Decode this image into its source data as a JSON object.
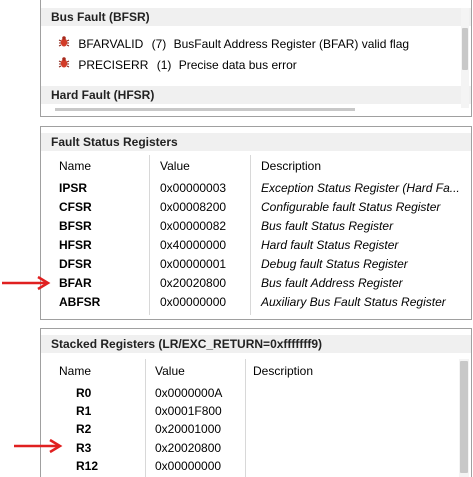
{
  "bfsr": {
    "title": "Bus Fault (BFSR)",
    "items": [
      {
        "name": "BFARVALID",
        "bit": "(7)",
        "desc": "BusFault Address Register (BFAR) valid flag"
      },
      {
        "name": "PRECISERR",
        "bit": "(1)",
        "desc": "Precise data bus error"
      }
    ],
    "next_title": "Hard Fault (HFSR)"
  },
  "fsr": {
    "title": "Fault Status Registers",
    "columns": [
      "Name",
      "Value",
      "Description"
    ],
    "rows": [
      {
        "name": "IPSR",
        "value": "0x00000003",
        "desc": "Exception Status Register (Hard Fa..."
      },
      {
        "name": "CFSR",
        "value": "0x00008200",
        "desc": "Configurable fault Status Register"
      },
      {
        "name": "BFSR",
        "value": "0x00000082",
        "desc": "Bus fault Status Register"
      },
      {
        "name": "HFSR",
        "value": "0x40000000",
        "desc": "Hard fault Status Register"
      },
      {
        "name": "DFSR",
        "value": "0x00000001",
        "desc": "Debug fault Status Register"
      },
      {
        "name": "BFAR",
        "value": "0x20020800",
        "desc": "Bus fault Address Register"
      },
      {
        "name": "ABFSR",
        "value": "0x00000000",
        "desc": "Auxiliary Bus Fault Status Register"
      }
    ]
  },
  "stacked": {
    "title": "Stacked Registers (LR/EXC_RETURN=0xfffffff9)",
    "columns": [
      "Name",
      "Value",
      "Description"
    ],
    "rows": [
      {
        "name": "R0",
        "value": "0x0000000A",
        "desc": ""
      },
      {
        "name": "R1",
        "value": "0x0001F800",
        "desc": ""
      },
      {
        "name": "R2",
        "value": "0x20001000",
        "desc": ""
      },
      {
        "name": "R3",
        "value": "0x20020800",
        "desc": ""
      },
      {
        "name": "R12",
        "value": "0x00000000",
        "desc": ""
      }
    ]
  },
  "colors": {
    "arrow": "#e02020",
    "bug": "#d23c28"
  },
  "icons": {
    "fault_flag": "bug-icon",
    "annotation": "red-arrow"
  }
}
